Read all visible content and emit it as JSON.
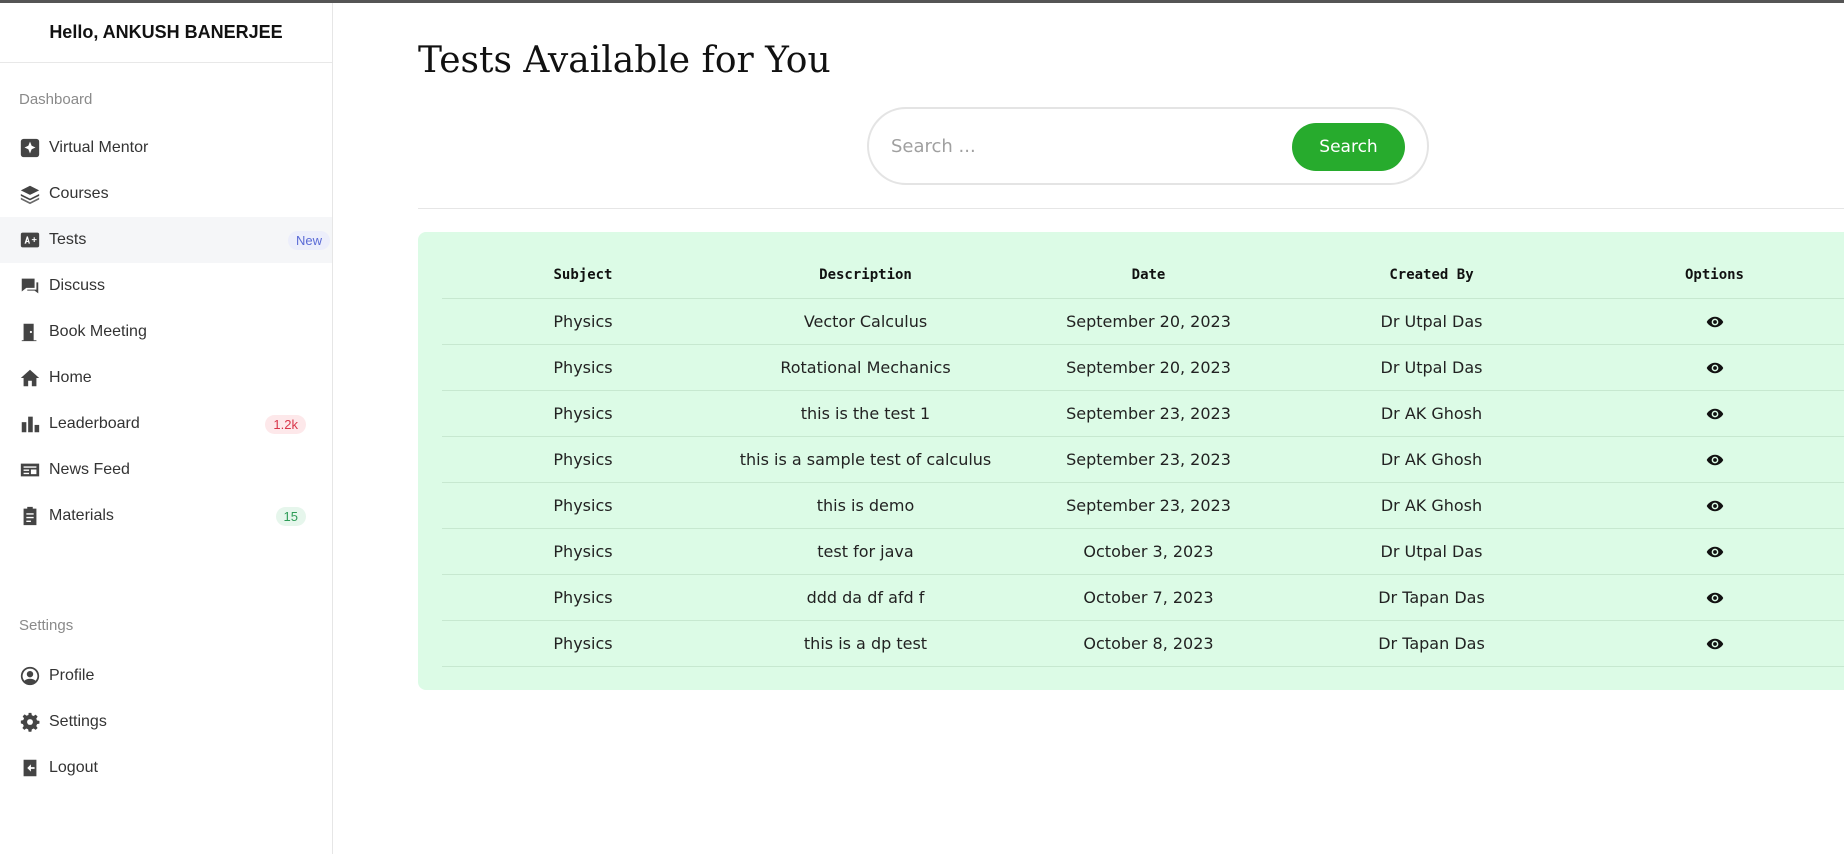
{
  "sidebar": {
    "greeting": "Hello, ANKUSH BANERJEE",
    "dashboard_label": "Dashboard",
    "settings_label": "Settings",
    "items": [
      {
        "label": "Virtual Mentor",
        "icon": "sparkle-icon"
      },
      {
        "label": "Courses",
        "icon": "layers-icon"
      },
      {
        "label": "Tests",
        "icon": "grade-icon",
        "badge": "New",
        "active": true
      },
      {
        "label": "Discuss",
        "icon": "chat-icon"
      },
      {
        "label": "Book Meeting",
        "icon": "door-icon"
      },
      {
        "label": "Home",
        "icon": "home-icon"
      },
      {
        "label": "Leaderboard",
        "icon": "bar-chart-icon",
        "badge": "1.2k"
      },
      {
        "label": "News Feed",
        "icon": "newspaper-icon"
      },
      {
        "label": "Materials",
        "icon": "clipboard-icon",
        "badge": "15"
      }
    ],
    "settings_items": [
      {
        "label": "Profile",
        "icon": "user-circle-icon"
      },
      {
        "label": "Settings",
        "icon": "gear-icon"
      },
      {
        "label": "Logout",
        "icon": "logout-icon"
      }
    ]
  },
  "main": {
    "title": "Tests Available for You",
    "search": {
      "placeholder": "Search ...",
      "button_label": "Search"
    },
    "table": {
      "headers": [
        "Subject",
        "Description",
        "Date",
        "Created By",
        "Options"
      ],
      "rows": [
        [
          "Physics",
          "Vector Calculus",
          "September 20, 2023",
          "Dr Utpal Das"
        ],
        [
          "Physics",
          "Rotational Mechanics",
          "September 20, 2023",
          "Dr Utpal Das"
        ],
        [
          "Physics",
          "this is the test 1",
          "September 23, 2023",
          "Dr AK Ghosh"
        ],
        [
          "Physics",
          "this is a sample test of calculus",
          "September 23, 2023",
          "Dr AK Ghosh"
        ],
        [
          "Physics",
          "this is demo",
          "September 23, 2023",
          "Dr AK Ghosh"
        ],
        [
          "Physics",
          "test for java",
          "October 3, 2023",
          "Dr Utpal Das"
        ],
        [
          "Physics",
          "ddd da df afd f",
          "October 7, 2023",
          "Dr Tapan Das"
        ],
        [
          "Physics",
          "this is a dp test",
          "October 8, 2023",
          "Dr Tapan Das"
        ]
      ]
    }
  },
  "colors": {
    "accent": "#27ab2d",
    "table_bg": "#dcfbe6",
    "active_bg": "#f5f6f8"
  }
}
